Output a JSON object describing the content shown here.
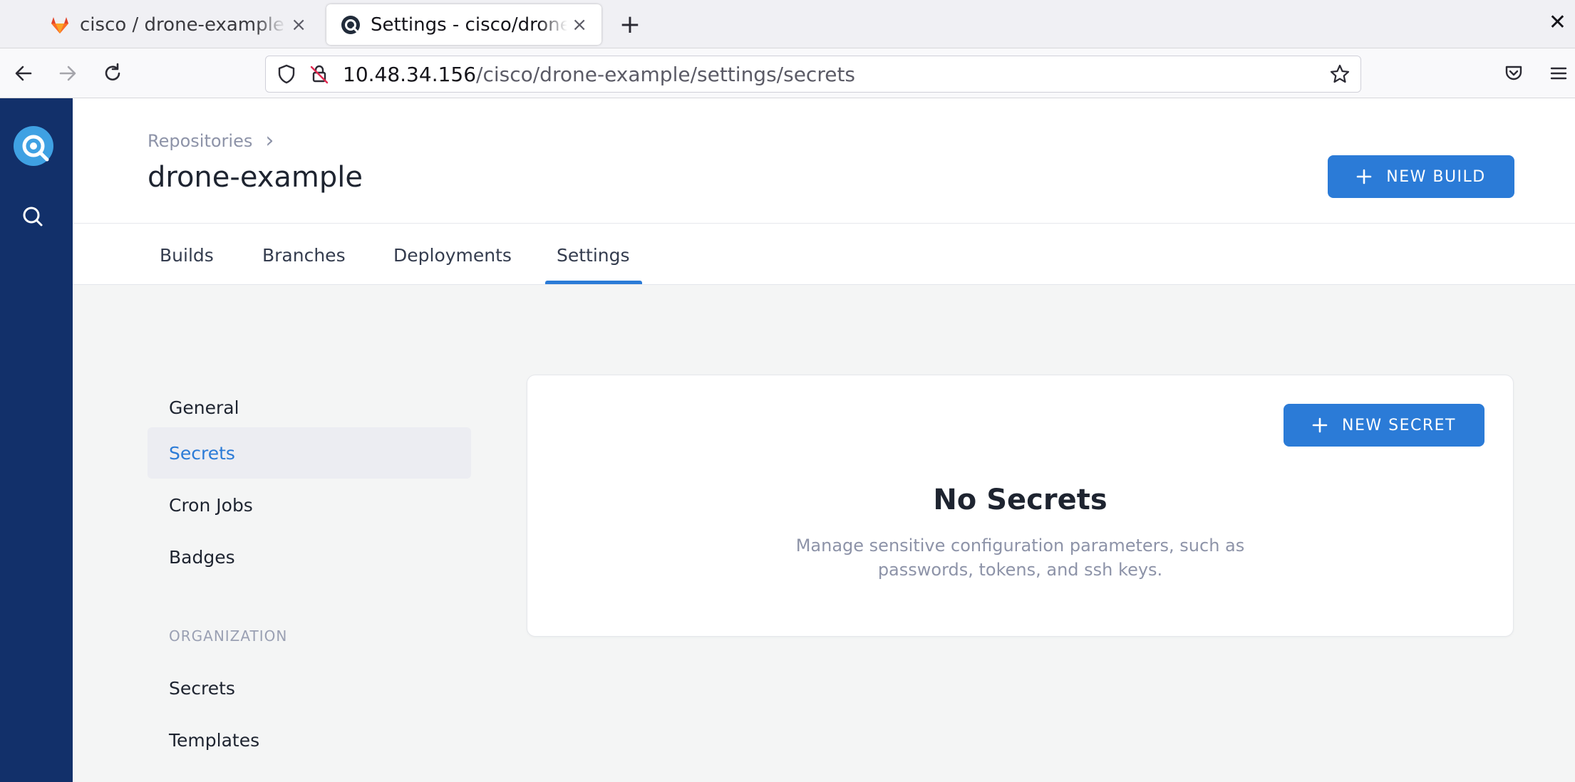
{
  "browser": {
    "tabs": [
      {
        "title": "cisco / drone-example · GitLab",
        "favicon": "gitlab-icon",
        "active": false
      },
      {
        "title": "Settings - cisco/drone-example",
        "favicon": "drone-icon",
        "active": true
      }
    ],
    "url_host": "10.48.34.156",
    "url_path": "/cisco/drone-example/settings/secrets",
    "close_glyph": "×",
    "new_tab_glyph": "+",
    "window_close_glyph": "✕"
  },
  "app": {
    "accent_color": "#2b7bd7",
    "sidebar_color": "#12306a",
    "breadcrumb": "Repositories",
    "breadcrumb_separator": "›",
    "title": "drone-example",
    "new_build_label": "NEW BUILD",
    "tabs": [
      {
        "label": "Builds"
      },
      {
        "label": "Branches"
      },
      {
        "label": "Deployments"
      },
      {
        "label": "Settings",
        "active": true
      }
    ],
    "settings_nav": {
      "items": [
        {
          "label": "General"
        },
        {
          "label": "Secrets",
          "active": true
        },
        {
          "label": "Cron Jobs"
        },
        {
          "label": "Badges"
        }
      ],
      "org_heading": "ORGANIZATION",
      "org_items": [
        {
          "label": "Secrets"
        },
        {
          "label": "Templates"
        }
      ]
    },
    "panel": {
      "new_secret_label": "NEW SECRET",
      "empty_title": "No Secrets",
      "empty_description": "Manage sensitive configuration parameters, such as passwords, tokens, and ssh keys."
    }
  }
}
